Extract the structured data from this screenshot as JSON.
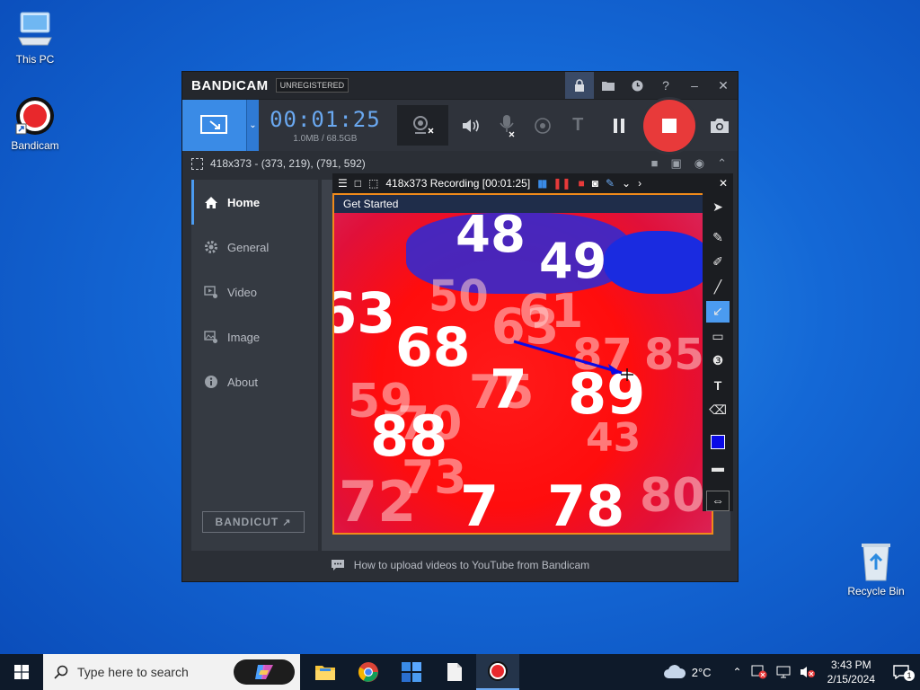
{
  "desktop": {
    "icons": [
      {
        "label": "This PC"
      },
      {
        "label": "Bandicam"
      },
      {
        "label": "Recycle Bin"
      }
    ]
  },
  "bandicam": {
    "brand": "BANDICAM",
    "badge": "UNREGISTERED",
    "timer": "00:01:25",
    "size": "1.0MB / 68.5GB",
    "region_info": "418x373 - (373, 219), (791, 592)",
    "sidebar": {
      "items": [
        {
          "label": "Home",
          "icon": "home-icon",
          "active": true
        },
        {
          "label": "General",
          "icon": "gear-icon",
          "active": false
        },
        {
          "label": "Video",
          "icon": "video-settings-icon",
          "active": false
        },
        {
          "label": "Image",
          "icon": "image-settings-icon",
          "active": false
        },
        {
          "label": "About",
          "icon": "info-icon",
          "active": false
        }
      ],
      "bandicut": "BANDICUT"
    },
    "footer": "How to upload videos to YouTube from Bandicam",
    "accent": "#3a8be6",
    "record_color": "#e83a3a"
  },
  "recording": {
    "title": "418x373 Recording [00:01:25]",
    "content_label": "Get Started",
    "frame_color": "#f08a1a",
    "numbers": [
      {
        "text": "48"
      },
      {
        "text": "49"
      },
      {
        "text": "63"
      },
      {
        "text": "68"
      },
      {
        "text": "7"
      },
      {
        "text": "89"
      },
      {
        "text": "88"
      },
      {
        "text": "7"
      },
      {
        "text": "78"
      }
    ],
    "ghost_numbers": [
      {
        "text": "50"
      },
      {
        "text": "63"
      },
      {
        "text": "87"
      },
      {
        "text": "85"
      },
      {
        "text": "59"
      },
      {
        "text": "75"
      },
      {
        "text": "70"
      },
      {
        "text": "43"
      },
      {
        "text": "72"
      },
      {
        "text": "73"
      },
      {
        "text": "80"
      },
      {
        "text": "61"
      }
    ],
    "pen_color": "#0a0ae6"
  },
  "taskbar": {
    "search_placeholder": "Type here to search",
    "weather": "2°C",
    "time": "3:43 PM",
    "date": "2/15/2024",
    "notification_count": "1"
  }
}
